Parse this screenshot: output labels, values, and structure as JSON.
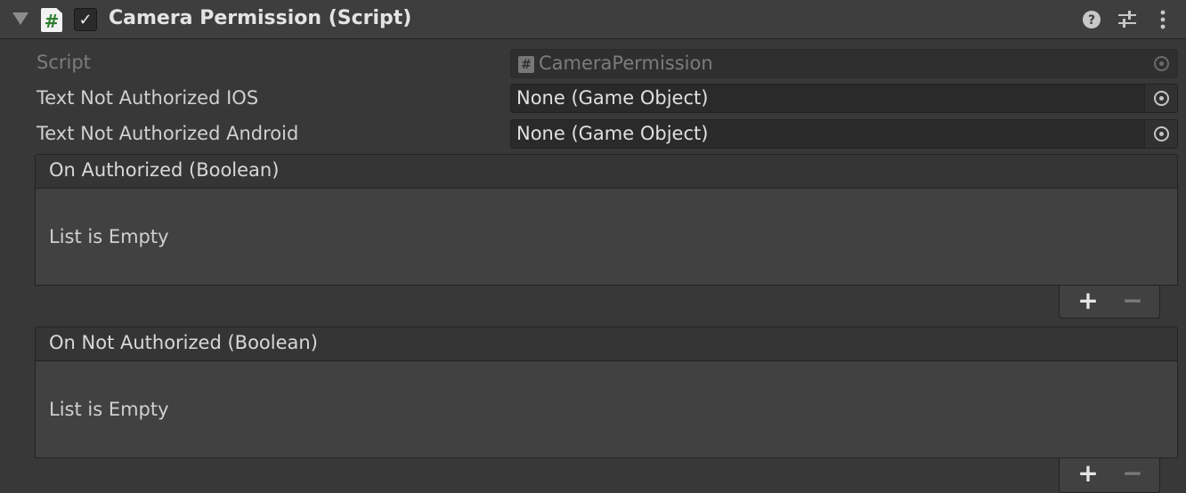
{
  "component": {
    "title": "Camera Permission (Script)",
    "enabled": true,
    "script_glyph": "#",
    "checkmark": "✓"
  },
  "header_icons": [
    "help-icon",
    "presets-icon",
    "more-options-icon"
  ],
  "properties": [
    {
      "label": "Script",
      "value": "CameraPermission",
      "disabled": true
    },
    {
      "label": "Text Not Authorized IOS",
      "value": "None (Game Object)",
      "disabled": false
    },
    {
      "label": "Text Not Authorized Android",
      "value": "None (Game Object)",
      "disabled": false
    }
  ],
  "events": [
    {
      "title": "On Authorized (Boolean)",
      "empty_text": "List is Empty"
    },
    {
      "title": "On Not Authorized (Boolean)",
      "empty_text": "List is Empty"
    }
  ],
  "list_buttons": {
    "add": "+",
    "remove": "−"
  }
}
